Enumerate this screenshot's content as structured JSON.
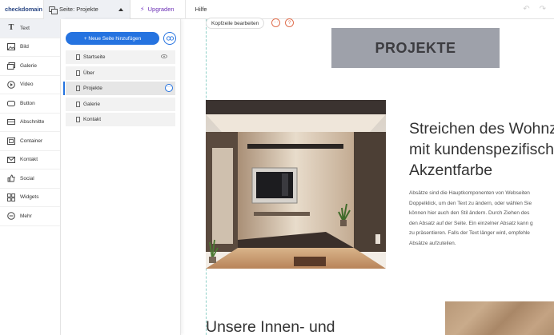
{
  "topbar": {
    "logo": "checkdomain",
    "page_select_label": "Seite: Projekte",
    "upgrade_label": "Upgraden",
    "help_label": "Hilfe"
  },
  "sidebar": {
    "items": [
      {
        "label": "Text",
        "icon": "text-icon"
      },
      {
        "label": "Bild",
        "icon": "image-icon"
      },
      {
        "label": "Galerie",
        "icon": "gallery-icon"
      },
      {
        "label": "Video",
        "icon": "video-icon"
      },
      {
        "label": "Button",
        "icon": "button-icon"
      },
      {
        "label": "Abschnitte",
        "icon": "sections-icon"
      },
      {
        "label": "Container",
        "icon": "container-icon"
      },
      {
        "label": "Kontakt",
        "icon": "contact-icon"
      },
      {
        "label": "Social",
        "icon": "thumbs-up-icon"
      },
      {
        "label": "Widgets",
        "icon": "widgets-icon"
      },
      {
        "label": "Mehr",
        "icon": "more-icon"
      }
    ]
  },
  "pages_panel": {
    "add_page_label": "+ Neue Seite hinzufügen",
    "pages": [
      {
        "label": "Startseite"
      },
      {
        "label": "Über"
      },
      {
        "label": "Projekte"
      },
      {
        "label": "Galerie"
      },
      {
        "label": "Kontakt"
      }
    ]
  },
  "canvas": {
    "header_edit_label": "Kopfzeile bearbeiten",
    "header_more": "···",
    "header_help": "?",
    "title_box": "PROJEKTE",
    "heading_lines": [
      "Streichen des Wohnz",
      "mit kundenspezifisch",
      "Akzentfarbe"
    ],
    "paragraph_lines": [
      "Absätze sind die Hauptkomponenten von Webseiten",
      "Doppelklick, um den Text zu ändern, oder wählen Sie",
      "können hier auch den Stil ändern. Durch Ziehen des",
      "den Absatz auf der Seite. Ein einzelner Absatz kann g",
      "zu präsentieren. Falls der Text länger wird, empfehle",
      "Absätze aufzuteilen."
    ],
    "heading2": "Unsere Innen- und"
  },
  "colors": {
    "accent": "#2573e0",
    "upgrade": "#6b2fb5",
    "title_box_bg": "#9ea1aa",
    "guide": "#8fd0c8"
  }
}
